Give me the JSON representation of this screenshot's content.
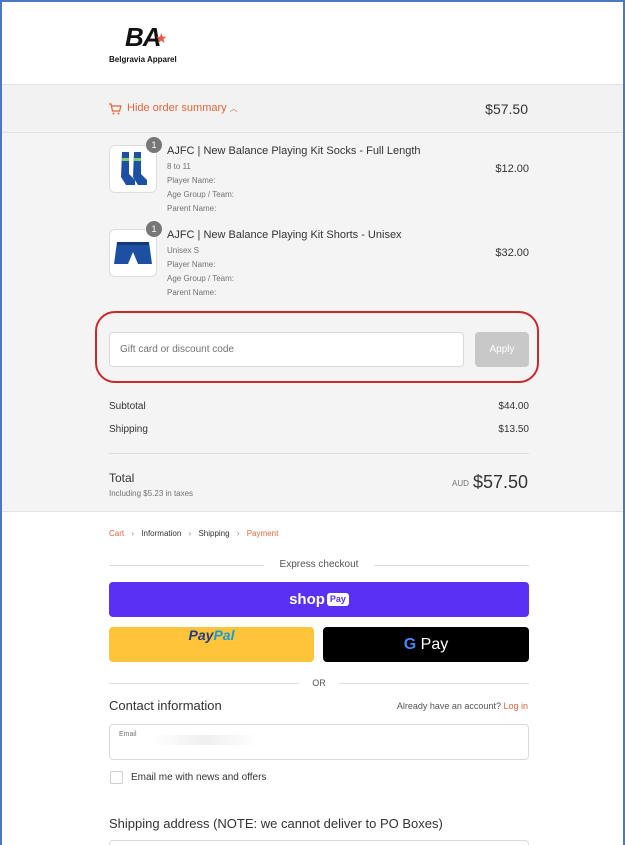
{
  "brand": {
    "logo_mark": "BA",
    "logo_text": "Belgravia Apparel"
  },
  "summary": {
    "toggle_label": "Hide order summary",
    "toggle_total": "$57.50",
    "items": [
      {
        "title": "AJFC | New Balance Playing Kit Socks - Full Length",
        "variant": "8 to 11",
        "player": "Player Name:",
        "age_group": "Age Group / Team:",
        "parent": "Parent Name:",
        "price": "$12.00",
        "quantity": "1"
      },
      {
        "title": "AJFC | New Balance Playing Kit Shorts - Unisex",
        "variant": "Unisex S",
        "player": "Player Name:",
        "age_group": "Age Group / Team:",
        "parent": "Parent Name:",
        "price": "$32.00",
        "quantity": "1"
      }
    ],
    "discount_placeholder": "Gift card or discount code",
    "apply_label": "Apply",
    "subtotal_label": "Subtotal",
    "subtotal_value": "$44.00",
    "shipping_label": "Shipping",
    "shipping_value": "$13.50",
    "total_label": "Total",
    "tax_note": "Including $5.23 in taxes",
    "currency": "AUD",
    "total_value": "$57.50"
  },
  "breadcrumb": {
    "cart": "Cart",
    "information": "Information",
    "shipping": "Shipping",
    "payment": "Payment"
  },
  "checkout": {
    "express_label": "Express checkout",
    "shop_label": "shop",
    "shop_pay_badge": "Pay",
    "paypal_part1": "Pay",
    "paypal_part2": "Pal",
    "gpay_g": "G",
    "gpay_label": " Pay",
    "or_label": "OR"
  },
  "contact": {
    "title": "Contact information",
    "account_question": "Already have an account?",
    "login_link": "Log in",
    "email_label": "Email",
    "newsletter_label": "Email me with news and offers"
  },
  "shipping": {
    "title": "Shipping address (NOTE: we cannot deliver to PO Boxes)"
  },
  "colors": {
    "accent": "#e0663d",
    "shop_pay": "#5a31f4",
    "paypal": "#ffc439",
    "highlight_ring": "#c92a2a"
  }
}
